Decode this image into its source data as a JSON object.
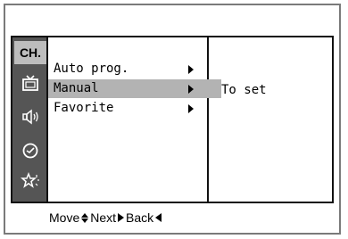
{
  "sidebar": {
    "active_tab": "CH.",
    "icons": [
      {
        "name": "tv-icon"
      },
      {
        "name": "speaker-icon"
      },
      {
        "name": "clock-icon"
      },
      {
        "name": "star-settings-icon"
      }
    ]
  },
  "menu": {
    "items": [
      {
        "label": "Auto prog.",
        "selected": false
      },
      {
        "label": "Manual",
        "selected": true
      },
      {
        "label": "Favorite",
        "selected": false
      }
    ]
  },
  "detail": {
    "text": "To set"
  },
  "footer": {
    "move": "Move",
    "next": "Next",
    "back": "Back"
  },
  "colors": {
    "sidebar_bg": "#555555",
    "tab_bg": "#bdbdbd",
    "selection_bg": "#b3b3b3",
    "frame_border": "#7a7a7a"
  }
}
